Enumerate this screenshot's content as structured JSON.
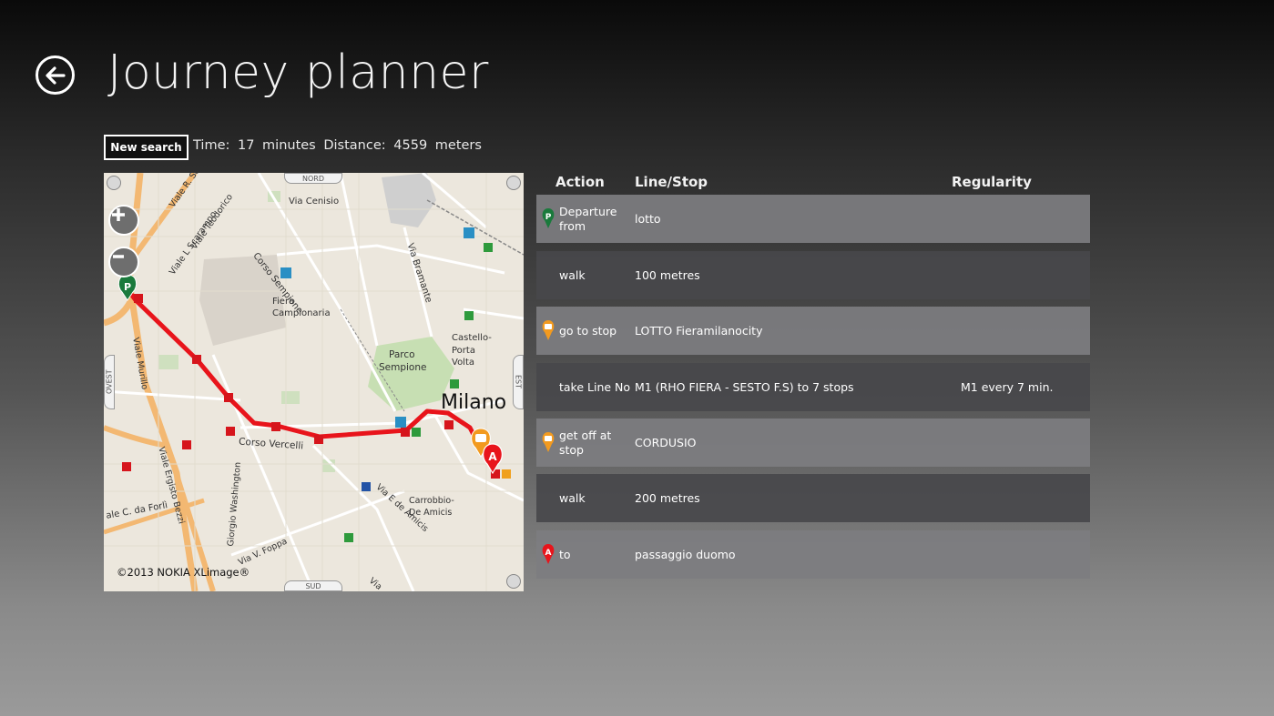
{
  "page": {
    "title": "Journey planner"
  },
  "toolbar": {
    "new_search_label": "New search"
  },
  "summary": {
    "time_label": "Time:",
    "time_value": "17",
    "time_unit": "minutes",
    "distance_label": "Distance:",
    "distance_value": "4559",
    "distance_unit": "meters"
  },
  "map": {
    "copyright": "©2013 NOKIA  XLimage®",
    "compass": {
      "north": "NORD",
      "south": "SUD",
      "west": "OVEST",
      "east": "EST"
    },
    "city_label": "Milano",
    "labels": {
      "via_cenisio": "Via Cenisio",
      "corso_sempione": "Corso Sempione",
      "via_bramante": "Via Bramante",
      "fiera": "Fiera",
      "campionaria": "Campionaria",
      "parco": "Parco",
      "sempione": "Sempione",
      "castello": "Castello-",
      "porta": "Porta",
      "volta": "Volta",
      "corso_vercelli": "Corso Vercelli",
      "via_murillo": "Viale Murillo",
      "viale_serra": "Viale R. Serra",
      "viale_teodorico": "Viale Teodorico",
      "viale_scarampo": "Viale L Scarampo",
      "viale_forli": "ale C. da Forlì",
      "viale_bezzi": "Viale Ergisto Bezzi",
      "via_washington": "Giorgio Washington",
      "via_foppa": "Via V. Foppa",
      "via_deamicis": "Via E de Amicis",
      "carrobbio": "Carrobbio-",
      "deamicis": "De Amicis",
      "via_bottom": "Via"
    },
    "route_color": "#e8141b"
  },
  "table": {
    "headers": {
      "action": "Action",
      "line_stop": "Line/Stop",
      "regularity": "Regularity"
    },
    "rows": [
      {
        "icon": "parking-pin-icon",
        "action": "Departure from",
        "stop": "lotto",
        "regularity": ""
      },
      {
        "icon": "",
        "action": "walk",
        "stop": "100 metres",
        "regularity": ""
      },
      {
        "icon": "bus-stop-pin-icon",
        "action": "go to stop",
        "stop": "LOTTO Fieramilanocity",
        "regularity": ""
      },
      {
        "icon": "",
        "action": "take Line No",
        "stop": "M1 (RHO FIERA - SESTO F.S) to 7 stops",
        "regularity": "M1 every 7 min."
      },
      {
        "icon": "bus-stop-pin-icon",
        "action": "get off at stop",
        "stop": "CORDUSIO",
        "regularity": ""
      },
      {
        "icon": "",
        "action": "walk",
        "stop": "200 metres",
        "regularity": ""
      },
      {
        "icon": "destination-pin-icon",
        "action": "to",
        "stop": "passaggio duomo",
        "regularity": ""
      }
    ]
  },
  "colors": {
    "pin_green": "#1a7a3c",
    "pin_orange": "#f29a1f",
    "pin_red": "#e8141b"
  }
}
